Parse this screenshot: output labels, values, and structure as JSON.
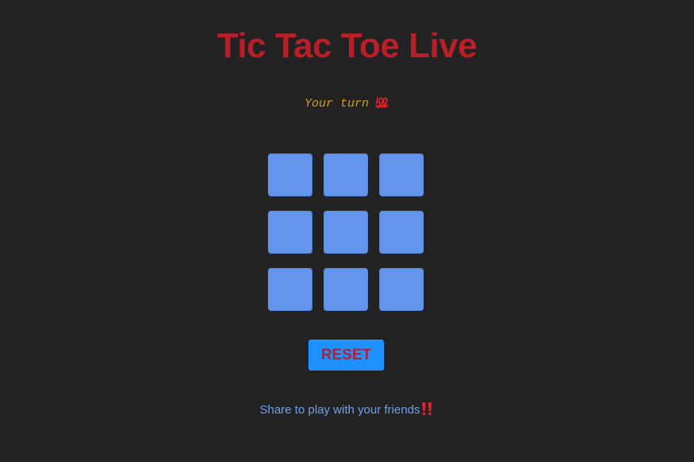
{
  "game": {
    "title": "Tic Tac Toe Live",
    "status_text": "Your turn",
    "status_icon": "hundred-points-icon",
    "board": [
      "",
      "",
      "",
      "",
      "",
      "",
      "",
      "",
      ""
    ],
    "reset_label": "RESET",
    "share_text": "Share to play with your friends",
    "share_icon": "double-exclamation-icon"
  },
  "colors": {
    "background": "#222222",
    "title": "#b81f29",
    "status": "#d49a2a",
    "cell": "#6495ed",
    "reset_bg": "#1e90ff",
    "reset_text": "#b81f29",
    "share_link": "#6ea2f0",
    "icon_red": "#e0242e"
  }
}
